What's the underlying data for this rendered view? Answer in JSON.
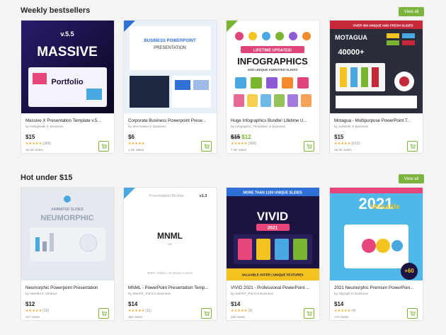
{
  "sections": [
    {
      "title": "Weekly bestsellers",
      "view_all": "View all",
      "cards": [
        {
          "title": "Massive X Presentation Template v.5...",
          "author": "by Designkalk in Business",
          "price": "$15",
          "old_price": "",
          "rating_count": "(366)",
          "sales": "15.2K Sales",
          "thumb": {
            "bg": "#1a0d3d",
            "headline": "MASSIVE",
            "tag": "v.5.5",
            "sub": "Portfolio",
            "accent": "#e8457a"
          }
        },
        {
          "title": "Corporate Business Powerpoint Prese...",
          "author": "by SeCreative in Business",
          "price": "$6",
          "old_price": "",
          "rating_count": "",
          "sales": "1.5K Sales",
          "thumb": {
            "bg": "#e9f0f8",
            "headline": "BUSINESS POWERPOINT",
            "sub": "PRESENTATION",
            "accent": "#2f6fd8"
          }
        },
        {
          "title": "Huge Infographics Bundle! Lifetime U...",
          "author": "by Infographic_Templates in Business",
          "price": "$12",
          "old_price": "$15",
          "rating_count": "(160)",
          "sales": "7.6K Sales",
          "thumb": {
            "bg": "#ffffff",
            "headline": "INFOGRAPHICS",
            "tag": "LIFETIME UPDATES!",
            "sub": "3400 UNIQUE ANIMATED SLIDES",
            "accent": "#e0457a"
          }
        },
        {
          "title": "Motagua - Multipurpose PowerPoint T...",
          "author": "by Jetfabrik in Business",
          "price": "$15",
          "old_price": "",
          "rating_count": "(613)",
          "sales": "28.4K Sales",
          "thumb": {
            "bg": "#2b2d3a",
            "headline": "MOTAGUA",
            "tag": "OVER 300 UNIQUE AND FRESH SLIDES",
            "sub": "40000+",
            "accent": "#c6283a"
          }
        }
      ]
    },
    {
      "title": "Hot under $15",
      "view_all": "View all",
      "cards": [
        {
          "title": "Neumorphic Powerpoint Presentation",
          "author": "by Abert84 in Abstract",
          "price": "$12",
          "old_price": "",
          "rating_count": "(10)",
          "sales": "427 Sales",
          "thumb": {
            "bg": "#e4e8ef",
            "headline": "NEUMORPHIC",
            "tag": "ANIMATED SLIDES",
            "accent": "#4aa8e0"
          }
        },
        {
          "title": "MNML - PowerPoint Presentation Temp...",
          "author": "by SMART_Point in Business",
          "price": "$14",
          "old_price": "",
          "rating_count": "(11)",
          "sales": "354 Sales",
          "thumb": {
            "bg": "#ffffff",
            "headline": "MNML",
            "tag": "Presentation Builder",
            "sub": "v1.3",
            "accent": "#555555"
          }
        },
        {
          "title": "VIVID 2021 - Professional PowerPoint ...",
          "author": "by SMART_Point in Business",
          "price": "$14",
          "old_price": "",
          "rating_count": "(6)",
          "sales": "335 Sales",
          "thumb": {
            "bg": "#1b1340",
            "headline": "VIVID",
            "tag": "MORE THAN 1330 UNIQUE SLIDES",
            "sub": "2021",
            "accent": "#e8457a"
          }
        },
        {
          "title": "2021 Neumorphic Premium PowerPoin...",
          "author": "by Alfgraph in Business",
          "price": "$14",
          "old_price": "",
          "rating_count": "(4)",
          "sales": "170 Sales",
          "thumb": {
            "bg": "#4fb8e8",
            "headline": "Versatile",
            "tag": "2021",
            "sub": "+60",
            "accent": "#f3c320"
          }
        }
      ]
    }
  ],
  "stars": "★★★★★",
  "colors": {
    "accent": "#7db43d",
    "sale": "#79b530",
    "star": "#f1a51e"
  }
}
